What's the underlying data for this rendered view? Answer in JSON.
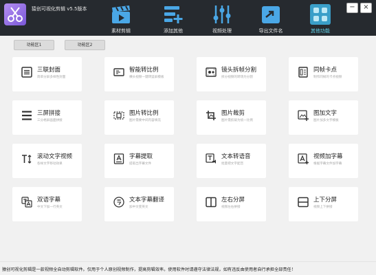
{
  "app": {
    "title": "猿创可视化剪辑 v5.5版本"
  },
  "toolbar": {
    "items": [
      {
        "label": "素材剪辑",
        "icon": "clapperboard-icon"
      },
      {
        "label": "添加其他",
        "icon": "list-add-icon"
      },
      {
        "label": "视频处理",
        "icon": "sliders-icon"
      },
      {
        "label": "导出文件名",
        "icon": "export-arrow-icon"
      },
      {
        "label": "其他功能",
        "icon": "grid-apps-icon"
      }
    ],
    "active_index": 4
  },
  "window_controls": {
    "minimize": "−",
    "close": "×"
  },
  "tabs": [
    {
      "label": "功能区1"
    },
    {
      "label": "功能区2"
    }
  ],
  "cards": [
    {
      "title": "三联封面",
      "subtitle": "简单分屏多样性封面",
      "icon": "triple-cover-icon"
    },
    {
      "title": "智能转比例",
      "subtitle": "横头视频一键转竖屏模板",
      "icon": "smart-ratio-icon"
    },
    {
      "title": "镜头拆帧分割",
      "subtitle": "拆分视频的转场为分割",
      "icon": "film-split-icon"
    },
    {
      "title": "同帧卡点",
      "subtitle": "制作同帧的卡点视频",
      "icon": "frame-beat-icon"
    },
    {
      "title": "三屏拼接",
      "subtitle": "三分格屏画面拼接",
      "icon": "three-screen-icon"
    },
    {
      "title": "图片转比例",
      "subtitle": "图片需要中间内容填充",
      "icon": "image-ratio-icon"
    },
    {
      "title": "图片裁剪",
      "subtitle": "图片需剪裁为统一比例",
      "icon": "image-crop-icon"
    },
    {
      "title": "图加文字",
      "subtitle": "图片加多文字模板",
      "icon": "image-text-icon"
    },
    {
      "title": "滚动文字视频",
      "subtitle": "各样文字移动效果",
      "icon": "scroll-text-icon"
    },
    {
      "title": "字幕提取",
      "subtitle": "提取出字幕文件",
      "icon": "subtitle-extract-icon"
    },
    {
      "title": "文本转语音",
      "subtitle": "批量把文字配音",
      "icon": "text-to-speech-icon"
    },
    {
      "title": "视频加字幕",
      "subtitle": "根据字幕文件加字幕",
      "icon": "video-subtitle-icon"
    },
    {
      "title": "双语字幕",
      "subtitle": "中文下加一行英文",
      "icon": "bilingual-icon"
    },
    {
      "title": "文本字幕翻译",
      "subtitle": "加中文变英文",
      "icon": "translate-icon"
    },
    {
      "title": "左右分屏",
      "subtitle": "视频左右拼接",
      "icon": "split-horizontal-icon"
    },
    {
      "title": "上下分屏",
      "subtitle": "视频上下拼接",
      "icon": "split-vertical-icon"
    }
  ],
  "status": {
    "text": "猿创可视化剪辑是一款视频全自动剪辑软件。仅用于个人原创视频制作，提高剪辑效率。使用软件时请遵守法律法规，如有违反由使用者自行承担全部责任！"
  }
}
